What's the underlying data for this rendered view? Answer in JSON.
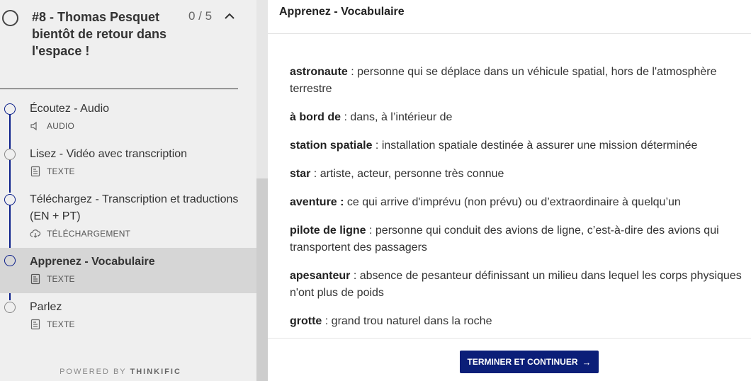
{
  "chapter": {
    "title": "#8 - Thomas Pesquet bientôt de retour dans l'espace !",
    "progress": "0 / 5"
  },
  "lessons": [
    {
      "title": "Écoutez - Audio",
      "type": "AUDIO",
      "icon": "speaker-icon"
    },
    {
      "title": "Lisez - Vidéo avec transcription",
      "type": "TEXTE",
      "icon": "text-doc-icon"
    },
    {
      "title": "Téléchargez - Transcription et traductions (EN + PT)",
      "type": "TÉLÉCHARGEMENT",
      "icon": "cloud-download-icon"
    },
    {
      "title": "Apprenez - Vocabulaire",
      "type": "TEXTE",
      "icon": "text-doc-icon",
      "active": true
    },
    {
      "title": "Parlez",
      "type": "TEXTE",
      "icon": "text-doc-icon"
    }
  ],
  "powered_by": {
    "prefix": "POWERED BY ",
    "brand": "THINKIFIC"
  },
  "main": {
    "heading": "Apprenez - Vocabulaire",
    "vocab": [
      {
        "term": "astronaute",
        "definition": " : personne qui se déplace dans un véhicule spatial, hors de l'atmosphère terrestre"
      },
      {
        "term": "à bord de",
        "definition": " : dans, à l’intérieur de"
      },
      {
        "term": "station spatiale",
        "definition": " : installation spatiale destinée à assurer une mission déterminée"
      },
      {
        "term": "star",
        "definition": " : artiste, acteur, personne très connue"
      },
      {
        "term": "aventure :",
        "definition": " ce qui arrive d'imprévu (non prévu) ou d’extraordinaire à quelqu’un"
      },
      {
        "term": "pilote de ligne",
        "definition": " : personne qui conduit des avions de ligne, c’est-à-dire des avions qui transportent des passagers"
      },
      {
        "term": "apesanteur",
        "definition": " : absence de pesanteur définissant un milieu dans lequel les corps physiques n'ont plus de poids"
      },
      {
        "term": "grotte",
        "definition": " : grand trou naturel dans la roche"
      }
    ],
    "finish_button": "TERMINER ET CONTINUER",
    "finish_arrow": "→"
  },
  "colors": {
    "accent": "#0b1e78",
    "timeline": "#0a1e8a",
    "sidebar_bg": "#efefef",
    "active_bg": "#d6d6d6"
  }
}
